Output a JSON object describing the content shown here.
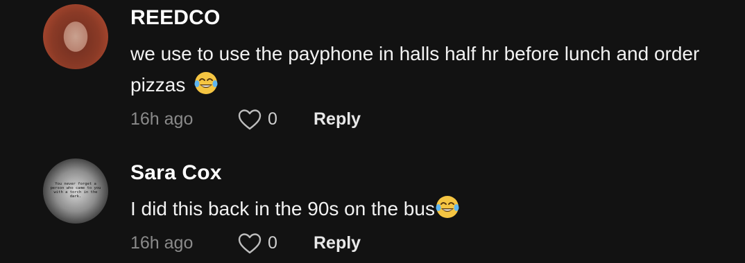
{
  "comments": [
    {
      "author": "REEDCO",
      "text": "we use to use the payphone in halls half hr before lunch and order pizzas",
      "emoji": "face-with-tears-of-joy",
      "time": "16h ago",
      "likes": "0",
      "reply_label": "Reply"
    },
    {
      "author": "Sara Cox",
      "text": "I did this back in the 90s on the bus",
      "emoji": "face-with-tears-of-joy",
      "time": "16h ago",
      "likes": "0",
      "reply_label": "Reply",
      "avatar_text": "You never forget a person who came to you with a torch in the dark."
    }
  ],
  "colors": {
    "background": "#121212",
    "author": "#ffffff",
    "text": "#f2f2f2",
    "meta": "#8a8a8a",
    "emoji": "#f5c542"
  }
}
